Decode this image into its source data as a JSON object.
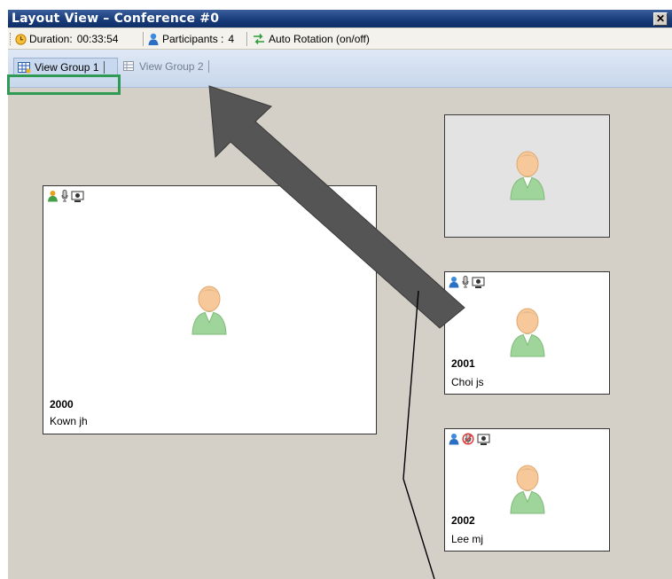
{
  "window": {
    "title": "Layout View – Conference #0",
    "close_label": "✕"
  },
  "toolbar": {
    "duration_label": "Duration:",
    "duration_value": "00:33:54",
    "participants_label": "Participants :",
    "participants_value": "4",
    "auto_rotation_label": "Auto Rotation (on/off)"
  },
  "tabs": [
    {
      "label": "View Group 1",
      "active": true
    },
    {
      "label": "View Group 2",
      "active": false
    }
  ],
  "panels": [
    {
      "ext": "2000",
      "name": "Kown jh",
      "mic_muted": false
    },
    {
      "ext": "",
      "name": "",
      "empty": true
    },
    {
      "ext": "2001",
      "name": "Choi js",
      "mic_muted": false
    },
    {
      "ext": "2002",
      "name": "Lee mj",
      "mic_muted": true
    }
  ],
  "colors": {
    "title_bar": "#173a78",
    "tab_bar": "#c8d7ec",
    "highlight_frame": "#2e9a54",
    "arrow": "#555555"
  }
}
